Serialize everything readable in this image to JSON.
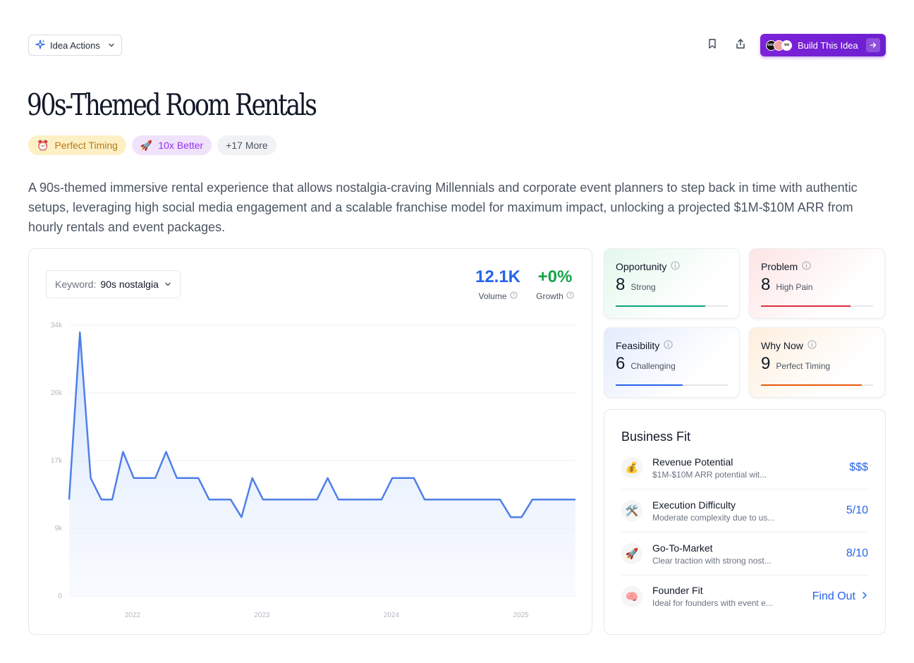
{
  "toolbar": {
    "idea_actions_label": "Idea Actions",
    "build_label": "Build This Idea",
    "avatars": [
      "ooo",
      "",
      "vo"
    ]
  },
  "page_title": "90s-Themed Room Rentals",
  "tags": [
    {
      "emoji": "⏰",
      "label": "Perfect Timing"
    },
    {
      "emoji": "🚀",
      "label": "10x Better"
    },
    {
      "label": "+17 More"
    }
  ],
  "description": "A 90s-themed immersive rental experience that allows nostalgia-craving Millennials and corporate event planners to step back in time with authentic setups, leveraging high social media engagement and a scalable franchise model for maximum impact, unlocking a projected $1M-$10M ARR from hourly rentals and event packages.",
  "keyword": {
    "label": "Keyword:",
    "value": "90s nostalgia"
  },
  "metrics": {
    "volume": {
      "value": "12.1K",
      "label": "Volume"
    },
    "growth": {
      "value": "+0%",
      "label": "Growth"
    }
  },
  "chart_data": {
    "type": "area",
    "y_ticks": [
      "0",
      "9k",
      "17k",
      "26k",
      "34k"
    ],
    "ylim": [
      0,
      34000
    ],
    "x_ticks": [
      "2022",
      "2023",
      "2024",
      "2025"
    ],
    "series": [
      {
        "values": [
          12100,
          33100,
          14800,
          12100,
          12100,
          18100,
          14800,
          14800,
          14800,
          18100,
          14800,
          14800,
          14800,
          12100,
          12100,
          12100,
          9900,
          14800,
          12100,
          12100,
          12100,
          12100,
          12100,
          12100,
          14800,
          12100,
          12100,
          12100,
          12100,
          12100,
          14800,
          14800,
          14800,
          12100,
          12100,
          12100,
          12100,
          12100,
          12100,
          12100,
          12100,
          9900,
          9900,
          12100,
          12100,
          12100,
          12100,
          12100
        ]
      }
    ],
    "color": "#4f7fe8",
    "grid": true
  },
  "scores": [
    {
      "label": "Opportunity",
      "value": "8",
      "sub": "Strong",
      "fill": 0.8,
      "color": "#10a37f"
    },
    {
      "label": "Problem",
      "value": "8",
      "sub": "High Pain",
      "fill": 0.8,
      "color": "#dc2f3e"
    },
    {
      "label": "Feasibility",
      "value": "6",
      "sub": "Challenging",
      "fill": 0.6,
      "color": "#2563eb"
    },
    {
      "label": "Why Now",
      "value": "9",
      "sub": "Perfect Timing",
      "fill": 0.9,
      "color": "#ea580c"
    }
  ],
  "business_fit": {
    "title": "Business Fit",
    "items": [
      {
        "icon": "💰",
        "name": "Revenue Potential",
        "desc": "$1M-$10M ARR potential wit...",
        "value": "$$$"
      },
      {
        "icon": "🛠️",
        "name": "Execution Difficulty",
        "desc": "Moderate complexity due to us...",
        "value": "5/10"
      },
      {
        "icon": "🚀",
        "name": "Go-To-Market",
        "desc": "Clear traction with strong nost...",
        "value": "8/10"
      },
      {
        "icon": "🧠",
        "name": "Founder Fit",
        "desc": "Ideal for founders with event e...",
        "value": "Find Out"
      }
    ]
  }
}
